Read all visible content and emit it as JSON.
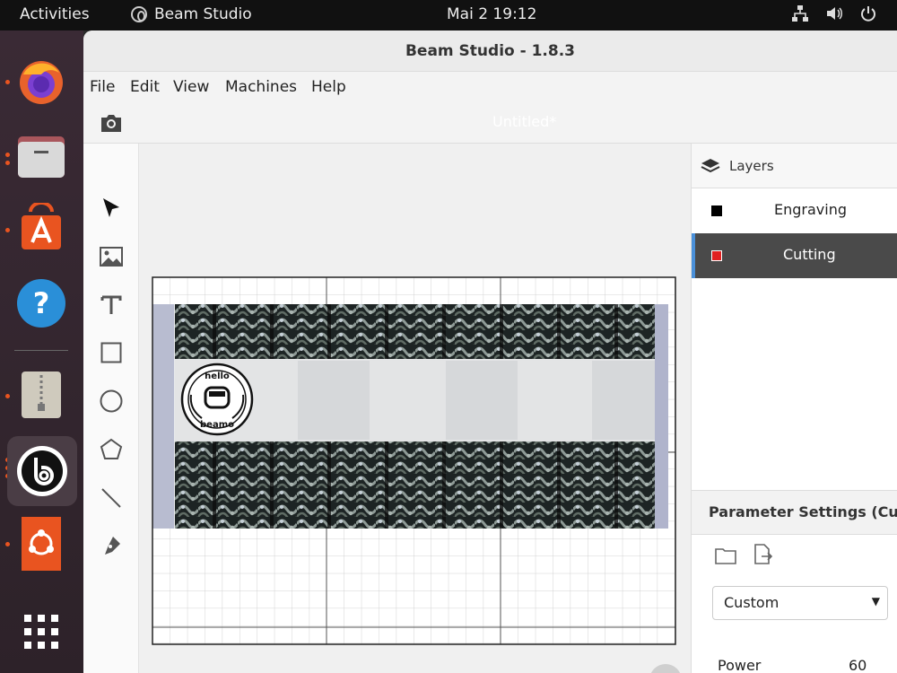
{
  "topbar": {
    "activities": "Activities",
    "app_name": "Beam Studio",
    "clock": "Mai 2  19:12"
  },
  "window": {
    "title": "Beam Studio - 1.8.3",
    "doc_title": "Untitled*"
  },
  "menu": {
    "file": "File",
    "edit": "Edit",
    "view": "View",
    "machines": "Machines",
    "help": "Help"
  },
  "layers": {
    "header": "Layers",
    "items": [
      {
        "name": "Engraving",
        "color": "#000000"
      },
      {
        "name": "Cutting",
        "color": "#e02020"
      }
    ]
  },
  "params": {
    "header": "Parameter Settings (Cutting)",
    "preset": "Custom",
    "power_label": "Power",
    "power_value": "60",
    "power_level": 0.6
  },
  "stamp": {
    "top": "hello",
    "bottom": "beamo"
  },
  "colors": {
    "accent": "#4a90d9",
    "ubuntu": "#e95420"
  }
}
